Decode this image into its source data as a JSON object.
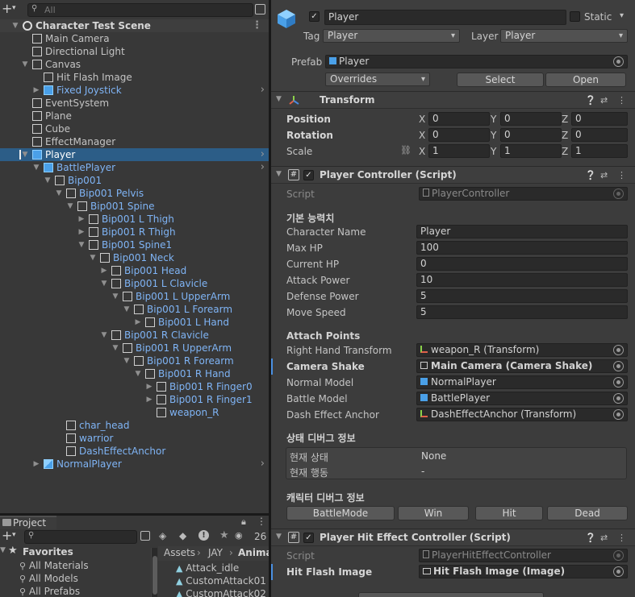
{
  "hierarchy": {
    "search_placeholder": "All",
    "rows": [
      {
        "label": "Character Test Scene",
        "depth": 0,
        "tri": "open",
        "icon": "unity-scene-icon",
        "kind": "scene"
      },
      {
        "label": "Main Camera",
        "depth": 1,
        "tri": "",
        "icon": "gameobject-icon",
        "kind": "go"
      },
      {
        "label": "Directional Light",
        "depth": 1,
        "tri": "",
        "icon": "gameobject-icon",
        "kind": "go"
      },
      {
        "label": "Canvas",
        "depth": 1,
        "tri": "open",
        "icon": "gameobject-icon",
        "kind": "go"
      },
      {
        "label": "Hit Flash Image",
        "depth": 2,
        "tri": "",
        "icon": "gameobject-icon",
        "kind": "go"
      },
      {
        "label": "Fixed Joystick",
        "depth": 2,
        "tri": "closed",
        "icon": "prefab-icon",
        "kind": "prefab",
        "chev": true
      },
      {
        "label": "EventSystem",
        "depth": 1,
        "tri": "",
        "icon": "gameobject-icon",
        "kind": "go"
      },
      {
        "label": "Plane",
        "depth": 1,
        "tri": "",
        "icon": "gameobject-icon",
        "kind": "go"
      },
      {
        "label": "Cube",
        "depth": 1,
        "tri": "",
        "icon": "gameobject-icon",
        "kind": "go"
      },
      {
        "label": "EffectManager",
        "depth": 1,
        "tri": "",
        "icon": "gameobject-icon",
        "kind": "go"
      },
      {
        "label": "Player",
        "depth": 1,
        "tri": "open",
        "icon": "prefab-icon",
        "kind": "sel",
        "chev": true
      },
      {
        "label": "BattlePlayer",
        "depth": 2,
        "tri": "open",
        "icon": "prefab-icon",
        "kind": "prefab",
        "chev": true
      },
      {
        "label": "Bip001",
        "depth": 3,
        "tri": "open",
        "icon": "gameobject-icon",
        "kind": "prefab"
      },
      {
        "label": "Bip001 Pelvis",
        "depth": 4,
        "tri": "open",
        "icon": "gameobject-icon",
        "kind": "prefab"
      },
      {
        "label": "Bip001 Spine",
        "depth": 5,
        "tri": "open",
        "icon": "gameobject-icon",
        "kind": "prefab"
      },
      {
        "label": "Bip001 L Thigh",
        "depth": 6,
        "tri": "closed",
        "icon": "gameobject-icon",
        "kind": "prefab"
      },
      {
        "label": "Bip001 R Thigh",
        "depth": 6,
        "tri": "closed",
        "icon": "gameobject-icon",
        "kind": "prefab"
      },
      {
        "label": "Bip001 Spine1",
        "depth": 6,
        "tri": "open",
        "icon": "gameobject-icon",
        "kind": "prefab"
      },
      {
        "label": "Bip001 Neck",
        "depth": 7,
        "tri": "open",
        "icon": "gameobject-icon",
        "kind": "prefab"
      },
      {
        "label": "Bip001 Head",
        "depth": 8,
        "tri": "closed",
        "icon": "gameobject-icon",
        "kind": "prefab"
      },
      {
        "label": "Bip001 L Clavicle",
        "depth": 8,
        "tri": "open",
        "icon": "gameobject-icon",
        "kind": "prefab"
      },
      {
        "label": "Bip001 L UpperArm",
        "depth": 9,
        "tri": "open",
        "icon": "gameobject-icon",
        "kind": "prefab"
      },
      {
        "label": "Bip001 L Forearm",
        "depth": 10,
        "tri": "open",
        "icon": "gameobject-icon",
        "kind": "prefab"
      },
      {
        "label": "Bip001 L Hand",
        "depth": 11,
        "tri": "closed",
        "icon": "gameobject-icon",
        "kind": "prefab"
      },
      {
        "label": "Bip001 R Clavicle",
        "depth": 8,
        "tri": "open",
        "icon": "gameobject-icon",
        "kind": "prefab"
      },
      {
        "label": "Bip001 R UpperArm",
        "depth": 9,
        "tri": "open",
        "icon": "gameobject-icon",
        "kind": "prefab"
      },
      {
        "label": "Bip001 R Forearm",
        "depth": 10,
        "tri": "open",
        "icon": "gameobject-icon",
        "kind": "prefab"
      },
      {
        "label": "Bip001 R Hand",
        "depth": 11,
        "tri": "open",
        "icon": "gameobject-icon",
        "kind": "prefab"
      },
      {
        "label": "Bip001 R Finger0",
        "depth": 12,
        "tri": "closed",
        "icon": "gameobject-icon",
        "kind": "prefab"
      },
      {
        "label": "Bip001 R Finger1",
        "depth": 12,
        "tri": "closed",
        "icon": "gameobject-icon",
        "kind": "prefab"
      },
      {
        "label": "weapon_R",
        "depth": 12,
        "tri": "",
        "icon": "gameobject-icon",
        "kind": "prefab"
      },
      {
        "label": "char_head",
        "depth": 4,
        "tri": "",
        "icon": "gameobject-icon",
        "kind": "prefab"
      },
      {
        "label": "warrior",
        "depth": 4,
        "tri": "",
        "icon": "gameobject-icon",
        "kind": "prefab"
      },
      {
        "label": "DashEffectAnchor",
        "depth": 4,
        "tri": "",
        "icon": "gameobject-icon",
        "kind": "prefab"
      },
      {
        "label": "NormalPlayer",
        "depth": 2,
        "tri": "closed",
        "icon": "prefab-model-icon",
        "kind": "prefab",
        "chev": true
      }
    ]
  },
  "project": {
    "tab": "Project",
    "badge": "26",
    "favorites_label": "Favorites",
    "favorites": [
      "All Materials",
      "All Models",
      "All Prefabs"
    ],
    "breadcrumb": [
      "Assets",
      "JAY",
      "Anima"
    ],
    "files": [
      "Attack_idle",
      "CustomAttack01",
      "CustomAttack02"
    ]
  },
  "inspector": {
    "name": "Player",
    "static_label": "Static",
    "tag_label": "Tag",
    "tag_value": "Player",
    "layer_label": "Layer",
    "layer_value": "Player",
    "prefab_label": "Prefab",
    "prefab_value": "Player",
    "overrides": "Overrides",
    "select": "Select",
    "open": "Open",
    "transform": {
      "title": "Transform",
      "rows": [
        {
          "label": "Position",
          "x": "0",
          "y": "0",
          "z": "0",
          "bold": true
        },
        {
          "label": "Rotation",
          "x": "0",
          "y": "0",
          "z": "0",
          "bold": true
        },
        {
          "label": "Scale",
          "x": "1",
          "y": "1",
          "z": "1",
          "bold": false
        }
      ]
    },
    "pc": {
      "title": "Player Controller (Script)",
      "script_label": "Script",
      "script_value": "PlayerController",
      "stats_header": "기본 능력치",
      "stats": [
        {
          "label": "Character Name",
          "value": "Player"
        },
        {
          "label": "Max HP",
          "value": "100"
        },
        {
          "label": "Current HP",
          "value": "0"
        },
        {
          "label": "Attack Power",
          "value": "10"
        },
        {
          "label": "Defense Power",
          "value": "5"
        },
        {
          "label": "Move Speed",
          "value": "5"
        }
      ],
      "attach_header": "Attach Points",
      "attach": [
        {
          "label": "Right Hand Transform",
          "value": "weapon_R (Transform)",
          "icon": "transform-icon",
          "bold": false
        },
        {
          "label": "Camera Shake",
          "value": "Main Camera (Camera Shake)",
          "icon": "script-icon",
          "bold": true
        },
        {
          "label": "Normal Model",
          "value": "NormalPlayer",
          "icon": "prefab-icon",
          "bold": false
        },
        {
          "label": "Battle Model",
          "value": "BattlePlayer",
          "icon": "prefab-icon",
          "bold": false
        },
        {
          "label": "Dash Effect Anchor",
          "value": "DashEffectAnchor (Transform)",
          "icon": "transform-icon",
          "bold": false
        }
      ],
      "state_header": "상태 디버그 정보",
      "state_rows": [
        {
          "label": "현재 상태",
          "value": "None"
        },
        {
          "label": "현재 행동",
          "value": "-"
        }
      ],
      "char_header": "캐릭터 디버그 정보",
      "buttons": [
        "BattleMode",
        "Win",
        "Hit",
        "Dead"
      ]
    },
    "hit": {
      "title": "Player Hit Effect Controller (Script)",
      "script_label": "Script",
      "script_value": "PlayerHitEffectController",
      "image_label": "Hit Flash Image",
      "image_value": "Hit Flash Image (Image)"
    }
  }
}
